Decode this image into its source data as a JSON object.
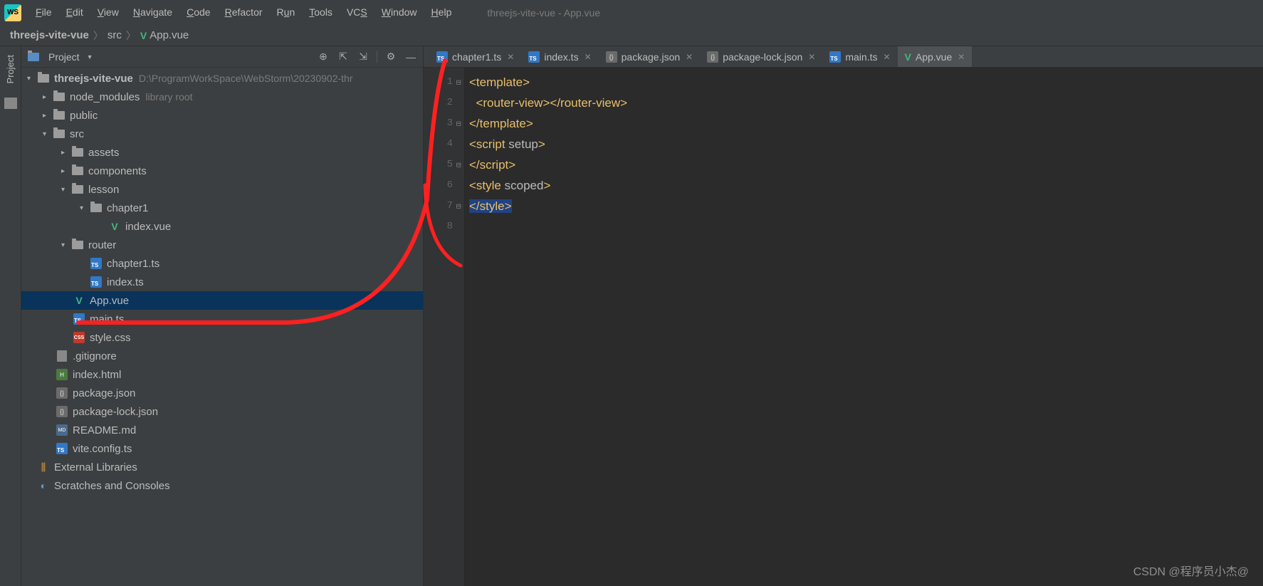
{
  "window_title": "threejs-vite-vue - App.vue",
  "menu": [
    "File",
    "Edit",
    "View",
    "Navigate",
    "Code",
    "Refactor",
    "Run",
    "Tools",
    "VCS",
    "Window",
    "Help"
  ],
  "breadcrumb": {
    "root": "threejs-vite-vue",
    "mid": "src",
    "file": "App.vue"
  },
  "panel_title": "Project",
  "tree": {
    "root": {
      "name": "threejs-vite-vue",
      "path": "D:\\ProgramWorkSpace\\WebStorm\\20230902-thr"
    },
    "node_modules": {
      "name": "node_modules",
      "hint": "library root"
    },
    "public": "public",
    "src": "src",
    "assets": "assets",
    "components": "components",
    "lesson": "lesson",
    "chapter1": "chapter1",
    "index_vue": "index.vue",
    "router": "router",
    "chapter1_ts": "chapter1.ts",
    "index_ts": "index.ts",
    "app_vue": "App.vue",
    "main_ts": "main.ts",
    "style_css": "style.css",
    "gitignore": ".gitignore",
    "index_html": "index.html",
    "package_json": "package.json",
    "package_lock": "package-lock.json",
    "readme": "README.md",
    "vite_config": "vite.config.ts",
    "ext_lib": "External Libraries",
    "scratches": "Scratches and Consoles"
  },
  "tabs": [
    {
      "label": "chapter1.ts",
      "type": "ts"
    },
    {
      "label": "index.ts",
      "type": "ts"
    },
    {
      "label": "package.json",
      "type": "json"
    },
    {
      "label": "package-lock.json",
      "type": "json"
    },
    {
      "label": "main.ts",
      "type": "ts"
    },
    {
      "label": "App.vue",
      "type": "vue",
      "active": true
    }
  ],
  "code": {
    "line_count": 8,
    "l1_a": "<template>",
    "l2_a": "<router-view>",
    "l2_b": "</router-view>",
    "l3_a": "</template>",
    "l4_a": "<script ",
    "l4_b": "setup",
    "l4_c": ">",
    "l5_a": "</script>",
    "l6_a": "<style ",
    "l6_b": "scoped",
    "l6_c": ">",
    "l7_a": "</style>"
  },
  "watermark": "CSDN @程序员小杰@"
}
